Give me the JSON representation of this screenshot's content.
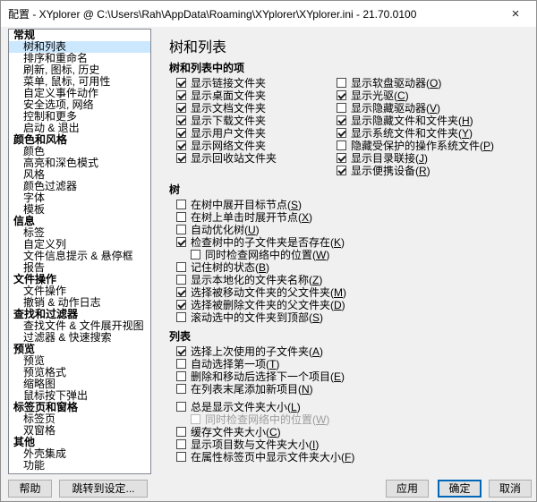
{
  "window": {
    "title": "配置 - XYplorer @ C:\\Users\\Rah\\AppData\\Roaming\\XYplorer\\XYplorer.ini - 21.70.0100",
    "close_icon": "×"
  },
  "colors": {
    "titlebar_bg": "#ffffff",
    "dialog_bg": "#f0f0f0",
    "selection_bg": "#cce8ff",
    "default_button_border": "#0067b8",
    "disabled_text": "#9d9d9d"
  },
  "sidebar": {
    "items": [
      {
        "label": "常规",
        "type": "header"
      },
      {
        "label": "树和列表",
        "type": "item",
        "selected": true
      },
      {
        "label": "排序和重命名",
        "type": "item"
      },
      {
        "label": "刷新, 图标, 历史",
        "type": "item"
      },
      {
        "label": "菜单, 鼠标, 可用性",
        "type": "item"
      },
      {
        "label": "自定义事件动作",
        "type": "item"
      },
      {
        "label": "安全选项, 网络",
        "type": "item"
      },
      {
        "label": "控制和更多",
        "type": "item"
      },
      {
        "label": "启动 & 退出",
        "type": "item"
      },
      {
        "label": "颜色和风格",
        "type": "header"
      },
      {
        "label": "颜色",
        "type": "item"
      },
      {
        "label": "高亮和深色模式",
        "type": "item"
      },
      {
        "label": "风格",
        "type": "item"
      },
      {
        "label": "颜色过滤器",
        "type": "item"
      },
      {
        "label": "字体",
        "type": "item"
      },
      {
        "label": "模板",
        "type": "item"
      },
      {
        "label": "信息",
        "type": "header"
      },
      {
        "label": "标签",
        "type": "item"
      },
      {
        "label": "自定义列",
        "type": "item"
      },
      {
        "label": "文件信息提示 & 悬停框",
        "type": "item"
      },
      {
        "label": "报告",
        "type": "item"
      },
      {
        "label": "文件操作",
        "type": "header"
      },
      {
        "label": "文件操作",
        "type": "item"
      },
      {
        "label": "撤销 & 动作日志",
        "type": "item"
      },
      {
        "label": "查找和过滤器",
        "type": "header"
      },
      {
        "label": "查找文件 & 文件展开视图",
        "type": "item"
      },
      {
        "label": "过滤器 & 快速搜索",
        "type": "item"
      },
      {
        "label": "预览",
        "type": "header"
      },
      {
        "label": "预览",
        "type": "item"
      },
      {
        "label": "预览格式",
        "type": "item"
      },
      {
        "label": "缩略图",
        "type": "item"
      },
      {
        "label": "鼠标按下弹出",
        "type": "item"
      },
      {
        "label": "标签页和窗格",
        "type": "header"
      },
      {
        "label": "标签页",
        "type": "item"
      },
      {
        "label": "双窗格",
        "type": "item"
      },
      {
        "label": "其他",
        "type": "header"
      },
      {
        "label": "外壳集成",
        "type": "item"
      },
      {
        "label": "功能",
        "type": "item"
      }
    ]
  },
  "panel": {
    "title": "树和列表",
    "sections": [
      {
        "header": "树和列表中的项",
        "left": [
          {
            "label": "显示链接文件夹",
            "checked": true
          },
          {
            "label": "显示桌面文件夹",
            "checked": true
          },
          {
            "label": "显示文档文件夹",
            "checked": true
          },
          {
            "label": "显示下载文件夹",
            "checked": true
          },
          {
            "label": "显示用户文件夹",
            "checked": true
          },
          {
            "label": "显示网络文件夹",
            "checked": true
          },
          {
            "label": "显示回收站文件夹",
            "checked": true
          }
        ],
        "right": [
          {
            "label": "显示软盘驱动器(O)",
            "checked": false
          },
          {
            "label": "显示光驱(C)",
            "checked": true
          },
          {
            "label": "显示隐藏驱动器(V)",
            "checked": false
          },
          {
            "label": "显示隐藏文件和文件夹(H)",
            "checked": true
          },
          {
            "label": "显示系统文件和文件夹(Y)",
            "checked": true
          },
          {
            "label": "隐藏受保护的操作系统文件(P)",
            "checked": false
          },
          {
            "label": "显示目录联接(J)",
            "checked": true
          },
          {
            "label": "显示便携设备(R)",
            "checked": true
          }
        ]
      },
      {
        "header": "树",
        "items": [
          {
            "label": "在树中展开目标节点(S)",
            "checked": false
          },
          {
            "label": "在树上单击时展开节点(X)",
            "checked": false
          },
          {
            "label": "自动优化树(U)",
            "checked": false
          },
          {
            "label": "检查树中的子文件夹是否存在(K)",
            "checked": true
          },
          {
            "label": "同时检查网络中的位置(W)",
            "checked": false,
            "indent": true
          },
          {
            "label": "记住树的状态(B)",
            "checked": false
          },
          {
            "label": "显示本地化的文件夹名称(Z)",
            "checked": false
          },
          {
            "label": "选择被移动文件夹的父文件夹(M)",
            "checked": true
          },
          {
            "label": "选择被删除文件夹的父文件夹(D)",
            "checked": true
          },
          {
            "label": "滚动选中的文件夹到顶部(S)",
            "checked": false
          }
        ]
      },
      {
        "header": "列表",
        "items": [
          {
            "label": "选择上次使用的子文件夹(A)",
            "checked": true
          },
          {
            "label": "自动选择第一项(T)",
            "checked": false
          },
          {
            "label": "删除和移动后选择下一个项目(E)",
            "checked": false
          },
          {
            "label": "在列表末尾添加新项目(N)",
            "checked": false
          },
          {
            "label": "总是显示文件夹大小(L)",
            "checked": false,
            "gap": true
          },
          {
            "label": "同时检查网络中的位置(W)",
            "checked": false,
            "indent": true,
            "disabled": true
          },
          {
            "label": "缓存文件夹大小(C)",
            "checked": false
          },
          {
            "label": "显示项目数与文件夹大小(I)",
            "checked": false
          },
          {
            "label": "在属性标签页中显示文件夹大小(F)",
            "checked": false
          }
        ]
      }
    ]
  },
  "footer": {
    "help_label": "帮助",
    "jump_label": "跳转到设定...",
    "apply_label": "应用",
    "ok_label": "确定",
    "cancel_label": "取消"
  }
}
